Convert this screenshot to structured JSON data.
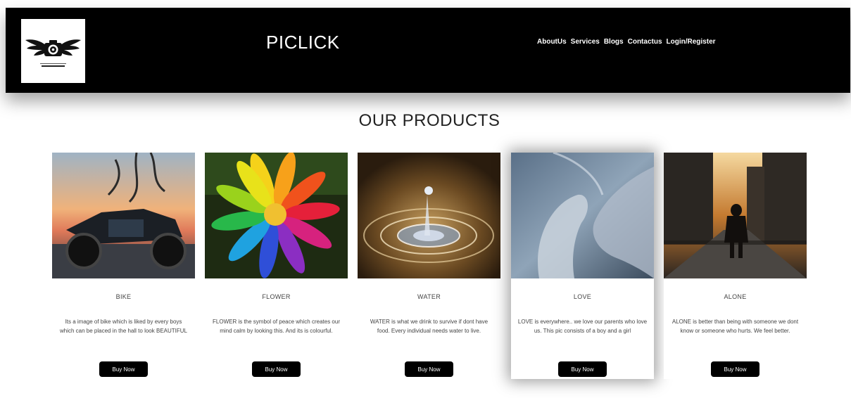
{
  "header": {
    "brand": "PICLICK",
    "nav": [
      "AboutUs",
      "Services",
      "Blogs",
      "Contactus",
      "Login/Register"
    ]
  },
  "section_title": "OUR PRODUCTS",
  "products": [
    {
      "title": "BIKE",
      "description": "Its a image of bike which is liked by every boys which can be placed in the hall to look BEAUTIFUL",
      "button": "Buy Now"
    },
    {
      "title": "FLOWER",
      "description": "FLOWER is the symbol of peace which creates our mind calm by looking this. And its is colourful.",
      "button": "Buy Now"
    },
    {
      "title": "WATER",
      "description": "WATER is what we drink to survive if dont have food. Every individual needs water to live.",
      "button": "Buy Now"
    },
    {
      "title": "LOVE",
      "description": "LOVE is everywhere.. we love our parents who love us. This pic consists of a boy and a girl",
      "button": "Buy Now"
    },
    {
      "title": "ALONE",
      "description": "ALONE is better than being with someone we dont know or someone who hurts. We feel better.",
      "button": "Buy Now"
    }
  ],
  "colors": {
    "header_bg": "#000000",
    "button_bg": "#000000",
    "button_text": "#ffffff",
    "page_bg": "#ffffff"
  },
  "icons": {
    "logo": "winged-camera-logo"
  }
}
